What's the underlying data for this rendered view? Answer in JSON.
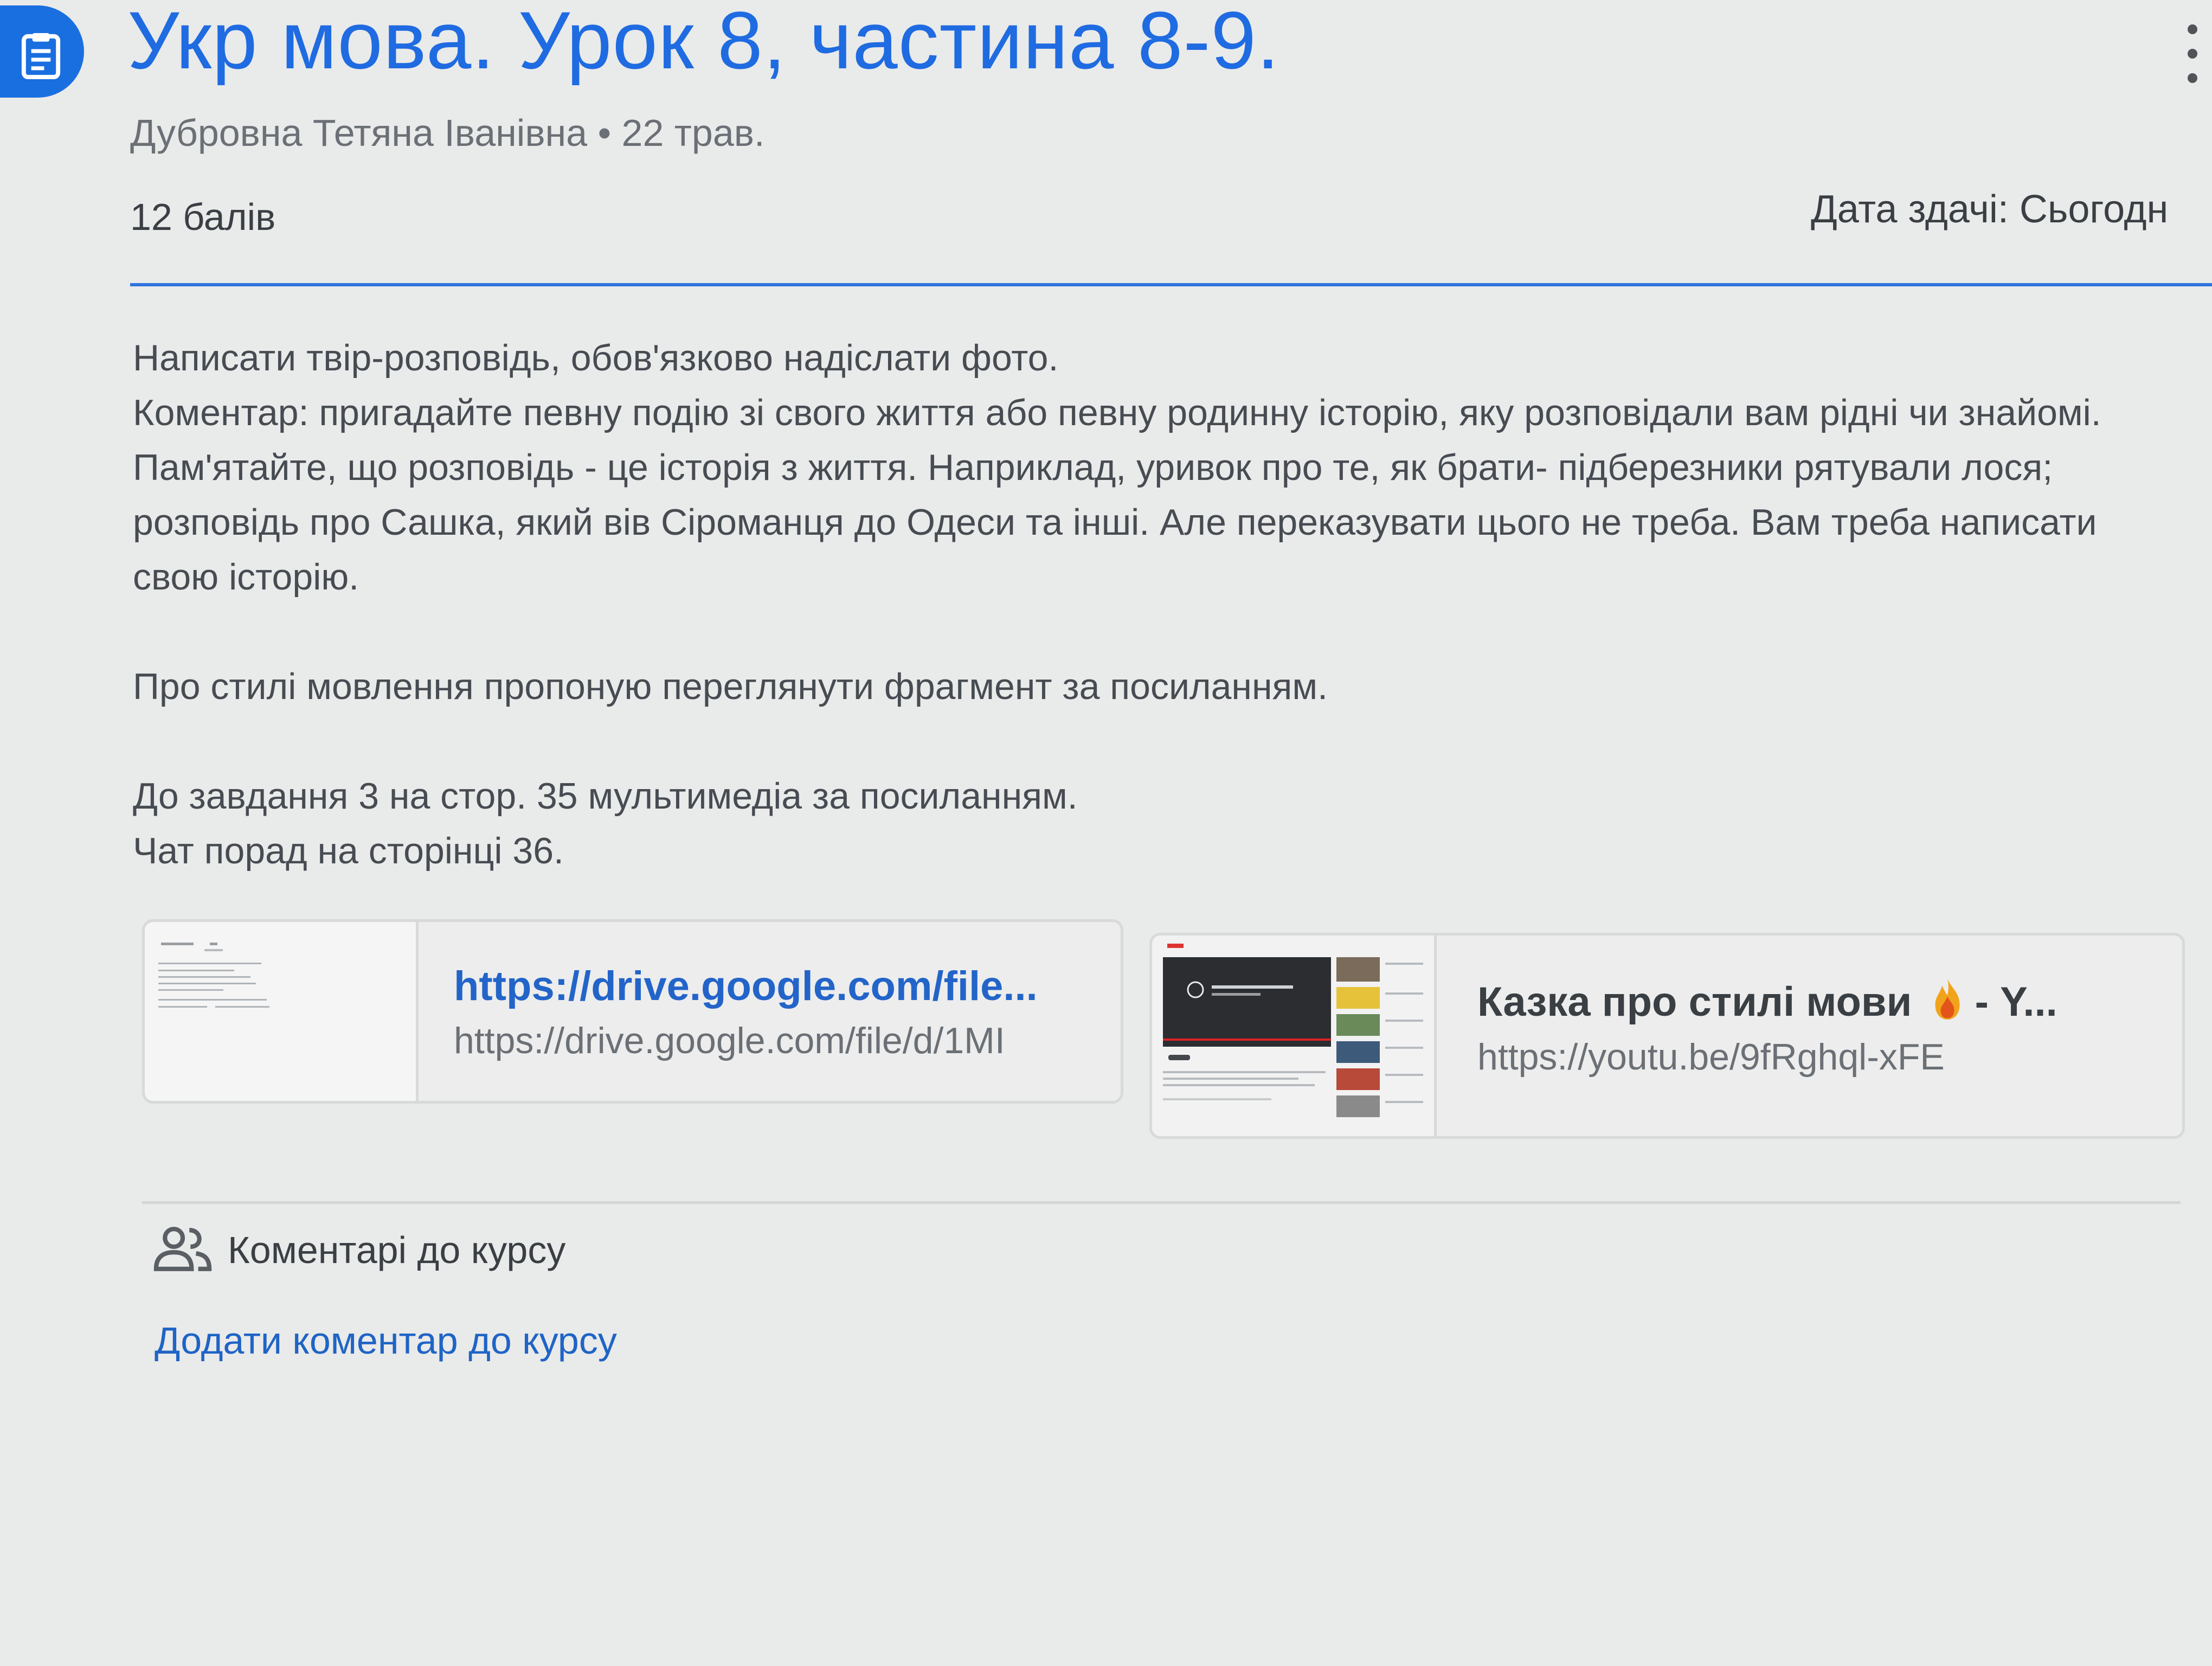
{
  "header": {
    "icon": "assignment-icon",
    "title": "Укр мова. Урок 8, частина 8-9.",
    "author": "Дубровна Тетяна Іванівна",
    "separator": "•",
    "date": "22 трав.",
    "points": "12 балів",
    "due": "Дата здачі: Сьогодн"
  },
  "description": {
    "line1": "Написати твір-розповідь, обов'язково надіслати фото.",
    "line2": "Коментар: пригадайте певну подію зі свого життя або певну родинну історію, яку розповідали вам рідні чи знайомі. Пам'ятайте, що розповідь - це історія з життя. Наприклад, уривок про те, як брати- підберезники рятували лося; розповідь про Сашка, який вів Сіроманця до Одеси та інші. Але переказувати цього не треба. Вам треба написати свою історію.",
    "line3": "Про стилі мовлення пропоную переглянути фрагмент за посиланням.",
    "line4": "До завдання 3 на стор. 35 мультимедіа за посиланням.",
    "line5": "Чат порад на сторінці 36."
  },
  "attachments": [
    {
      "title": "https://drive.google.com/file...",
      "url": "https://drive.google.com/file/d/1MI",
      "thumb_icon": "document-thumbnail"
    },
    {
      "title": "Казка про стилі мови",
      "title_suffix": " - Y...",
      "emoji": "fire-icon",
      "url": "https://youtu.be/9fRghql-xFE",
      "thumb_icon": "video-thumbnail"
    }
  ],
  "comments": {
    "icon": "people-icon",
    "label": "Коментарі до курсу",
    "add_link": "Додати коментар до курсу"
  },
  "colors": {
    "accent": "#1f6be1",
    "link": "#2364c9",
    "background": "#e9eaea"
  }
}
